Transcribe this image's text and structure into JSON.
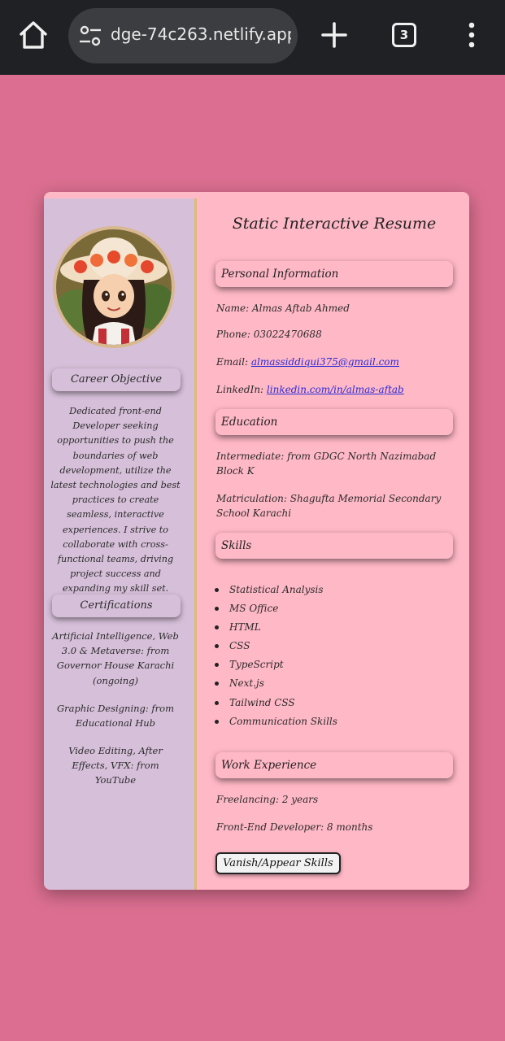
{
  "browser": {
    "url": "dge-74c263.netlify.app",
    "tab_count": "3",
    "icons": [
      "home-icon",
      "site-settings-icon",
      "new-tab-icon",
      "tab-switcher-icon",
      "more-menu-icon"
    ]
  },
  "colors": {
    "page_background": "#dc6f91",
    "card_background": "#ffb8c6",
    "sidebar_background": "#d6bfd9",
    "divider": "#dfb97a",
    "link": "#2b2bd6"
  },
  "sidebar": {
    "career_heading": "Career Objective",
    "career_text": "Dedicated front-end Developer seeking opportunities to push the boundaries of web development, utilize the latest technologies and best practices to create seamless, interactive experiences. I strive to collaborate with cross-functional teams, driving project success and expanding my skill set.",
    "cert_heading": "Certifications",
    "certs": [
      "Artificial Intelligence, Web 3.0 & Metaverse: from Governor House Karachi (ongoing)",
      "Graphic Designing: from Educational Hub",
      "Video Editing, After Effects, VFX: from YouTube"
    ]
  },
  "main": {
    "title": "Static Interactive Resume",
    "personal_heading": "Personal Information",
    "name": "Name: Almas Aftab Ahmed",
    "phone": "Phone: 03022470688",
    "email_label": "Email: ",
    "email": "almassiddiqui375@gmail.com",
    "linkedin_label": "LinkedIn: ",
    "linkedin": "linkedin.com/in/almas-aftab",
    "education_heading": "Education",
    "education": [
      "Intermediate: from GDGC North Nazimabad Block K",
      "Matriculation: Shagufta Memorial Secondary School Karachi"
    ],
    "skills_heading": "Skills",
    "skills": [
      "Statistical Analysis",
      "MS Office",
      "HTML",
      "CSS",
      "TypeScript",
      "Next.js",
      "Tailwind CSS",
      "Communication Skills"
    ],
    "work_heading": "Work Experience",
    "work": [
      "Freelancing: 2 years",
      "Front-End Developer: 8 months"
    ],
    "toggle_button": "Vanish/Appear Skills"
  }
}
